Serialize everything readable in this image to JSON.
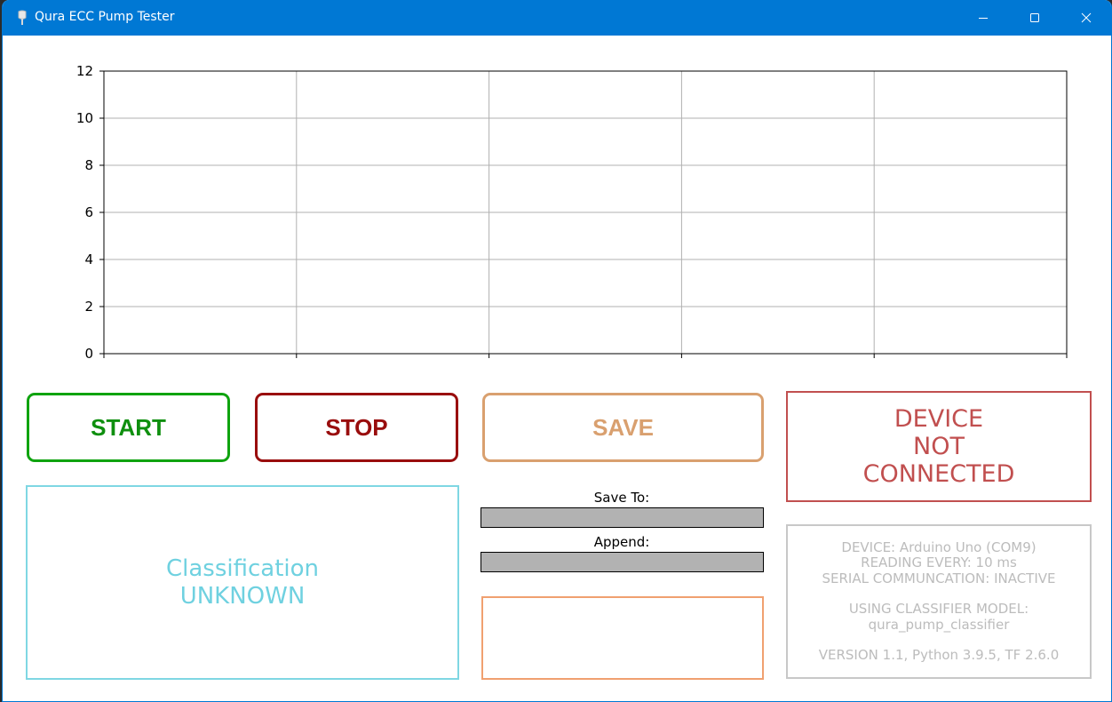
{
  "window": {
    "title": "Qura ECC Pump Tester",
    "accent": "#0078d4"
  },
  "chart_data": {
    "type": "line",
    "title": "",
    "xlabel": "",
    "ylabel": "",
    "series": [],
    "ylim": [
      0,
      12
    ],
    "y_ticks": [
      "0",
      "2",
      "4",
      "6",
      "8",
      "10",
      "12"
    ],
    "x_tick_count": 6,
    "grid": true
  },
  "buttons": {
    "start_label": "START",
    "stop_label": "STOP",
    "save_label": "SAVE"
  },
  "status": {
    "lines": [
      "DEVICE",
      "NOT",
      "CONNECTED"
    ],
    "color": "#c14f4f"
  },
  "classification": {
    "label": "Classification",
    "value": "UNKNOWN"
  },
  "save_panel": {
    "save_to_label": "Save To:",
    "save_to_value": "",
    "append_label": "Append:",
    "append_value": ""
  },
  "info": {
    "device": "DEVICE: Arduino Uno (COM9)",
    "reading": "READING EVERY: 10 ms",
    "serial": "SERIAL COMMUNCATION: INACTIVE",
    "model_label": "USING CLASSIFIER MODEL:",
    "model_name": "qura_pump_classifier",
    "version": "VERSION 1.1, Python 3.9.5, TF 2.6.0"
  }
}
